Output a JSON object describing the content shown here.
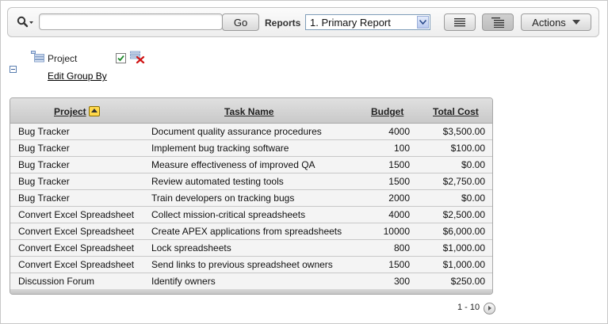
{
  "toolbar": {
    "search_placeholder": "",
    "go_label": "Go",
    "reports_label": "Reports",
    "report_selected": "1. Primary Report",
    "actions_label": "Actions",
    "icons": {
      "search": "search-icon",
      "report_view": "report-view-icon",
      "group_by_view": "group-by-view-icon",
      "dropdown": "chevron-down-icon"
    }
  },
  "control_panel": {
    "group_by_label": "Project",
    "group_by_enabled": true,
    "edit_link": "Edit Group By"
  },
  "table": {
    "columns": [
      {
        "key": "project",
        "label": "Project",
        "sorted": "ascending"
      },
      {
        "key": "task",
        "label": "Task Name"
      },
      {
        "key": "budget",
        "label": "Budget"
      },
      {
        "key": "cost",
        "label": "Total Cost"
      }
    ],
    "rows": [
      {
        "project": "Bug Tracker",
        "task": "Document quality assurance procedures",
        "budget": "4000",
        "cost": "$3,500.00"
      },
      {
        "project": "Bug Tracker",
        "task": "Implement bug tracking software",
        "budget": "100",
        "cost": "$100.00"
      },
      {
        "project": "Bug Tracker",
        "task": "Measure effectiveness of improved QA",
        "budget": "1500",
        "cost": "$0.00"
      },
      {
        "project": "Bug Tracker",
        "task": "Review automated testing tools",
        "budget": "1500",
        "cost": "$2,750.00"
      },
      {
        "project": "Bug Tracker",
        "task": "Train developers on tracking bugs",
        "budget": "2000",
        "cost": "$0.00"
      },
      {
        "project": "Convert Excel Spreadsheet",
        "task": "Collect mission-critical spreadsheets",
        "budget": "4000",
        "cost": "$2,500.00"
      },
      {
        "project": "Convert Excel Spreadsheet",
        "task": "Create APEX applications from spreadsheets",
        "budget": "10000",
        "cost": "$6,000.00"
      },
      {
        "project": "Convert Excel Spreadsheet",
        "task": "Lock spreadsheets",
        "budget": "800",
        "cost": "$1,000.00"
      },
      {
        "project": "Convert Excel Spreadsheet",
        "task": "Send links to previous spreadsheet owners",
        "budget": "1500",
        "cost": "$1,000.00"
      },
      {
        "project": "Discussion Forum",
        "task": "Identify owners",
        "budget": "300",
        "cost": "$250.00"
      }
    ]
  },
  "pagination": {
    "range": "1 - 10"
  }
}
